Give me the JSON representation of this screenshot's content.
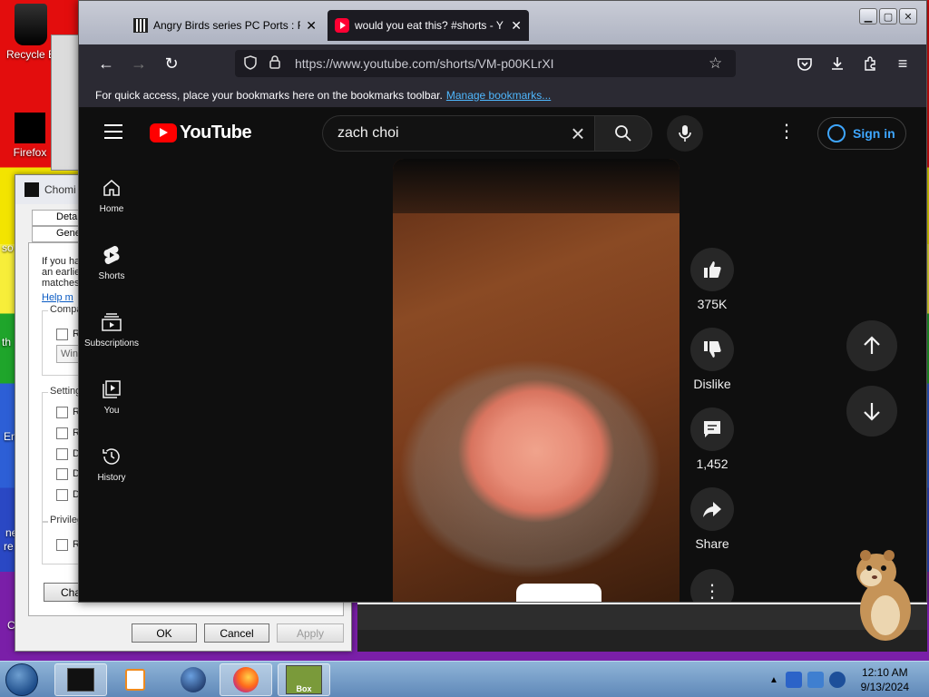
{
  "desktop": {
    "icons": [
      {
        "label": "Recycle B"
      },
      {
        "label": "Firefox"
      }
    ],
    "side_fragments": [
      "so",
      "th",
      "En",
      "ne",
      "re",
      "C"
    ]
  },
  "dialog": {
    "title": "Chomi",
    "tabs": [
      "Deta",
      "Genera"
    ],
    "text_lines": [
      "If you ha",
      "an earlie",
      "matches"
    ],
    "help_link": "Help m",
    "groups": [
      "Compa",
      "Setting",
      "Privileg"
    ],
    "check_labels": [
      "R",
      "R",
      "R",
      "D",
      "D",
      "D",
      "R"
    ],
    "combo_value": "Win",
    "change_button": "Cha",
    "ok": "OK",
    "cancel": "Cancel",
    "apply": "Apply"
  },
  "browser": {
    "tabs": [
      {
        "title": "Angry Birds series PC Ports : Ro",
        "close": "✕"
      },
      {
        "title": "would you eat this? #shorts - Y",
        "close": "✕"
      }
    ],
    "url": "https://www.youtube.com/shorts/VM-p00KLrXI",
    "bookmarks_text": "For quick access, place your bookmarks here on the bookmarks toolbar.",
    "bookmarks_link": "Manage bookmarks..."
  },
  "youtube": {
    "logo": "YouTube",
    "search_value": "zach choi",
    "sign_in": "Sign in",
    "sidebar": [
      {
        "label": "Home",
        "icon": "home-icon"
      },
      {
        "label": "Shorts",
        "icon": "shorts-icon"
      },
      {
        "label": "Subscriptions",
        "icon": "subscriptions-icon"
      },
      {
        "label": "You",
        "icon": "you-icon"
      },
      {
        "label": "History",
        "icon": "history-icon"
      }
    ],
    "actions": {
      "likes": "375K",
      "dislike": "Dislike",
      "comments": "1,452",
      "share": "Share"
    }
  },
  "taskbar": {
    "clock_time": "12:10 AM",
    "clock_date": "9/13/2024",
    "box_label": "Box"
  },
  "colors": {
    "yt_red": "#ff0000",
    "link_blue": "#3ea6ff",
    "bg_dark": "#0f0f0f"
  }
}
